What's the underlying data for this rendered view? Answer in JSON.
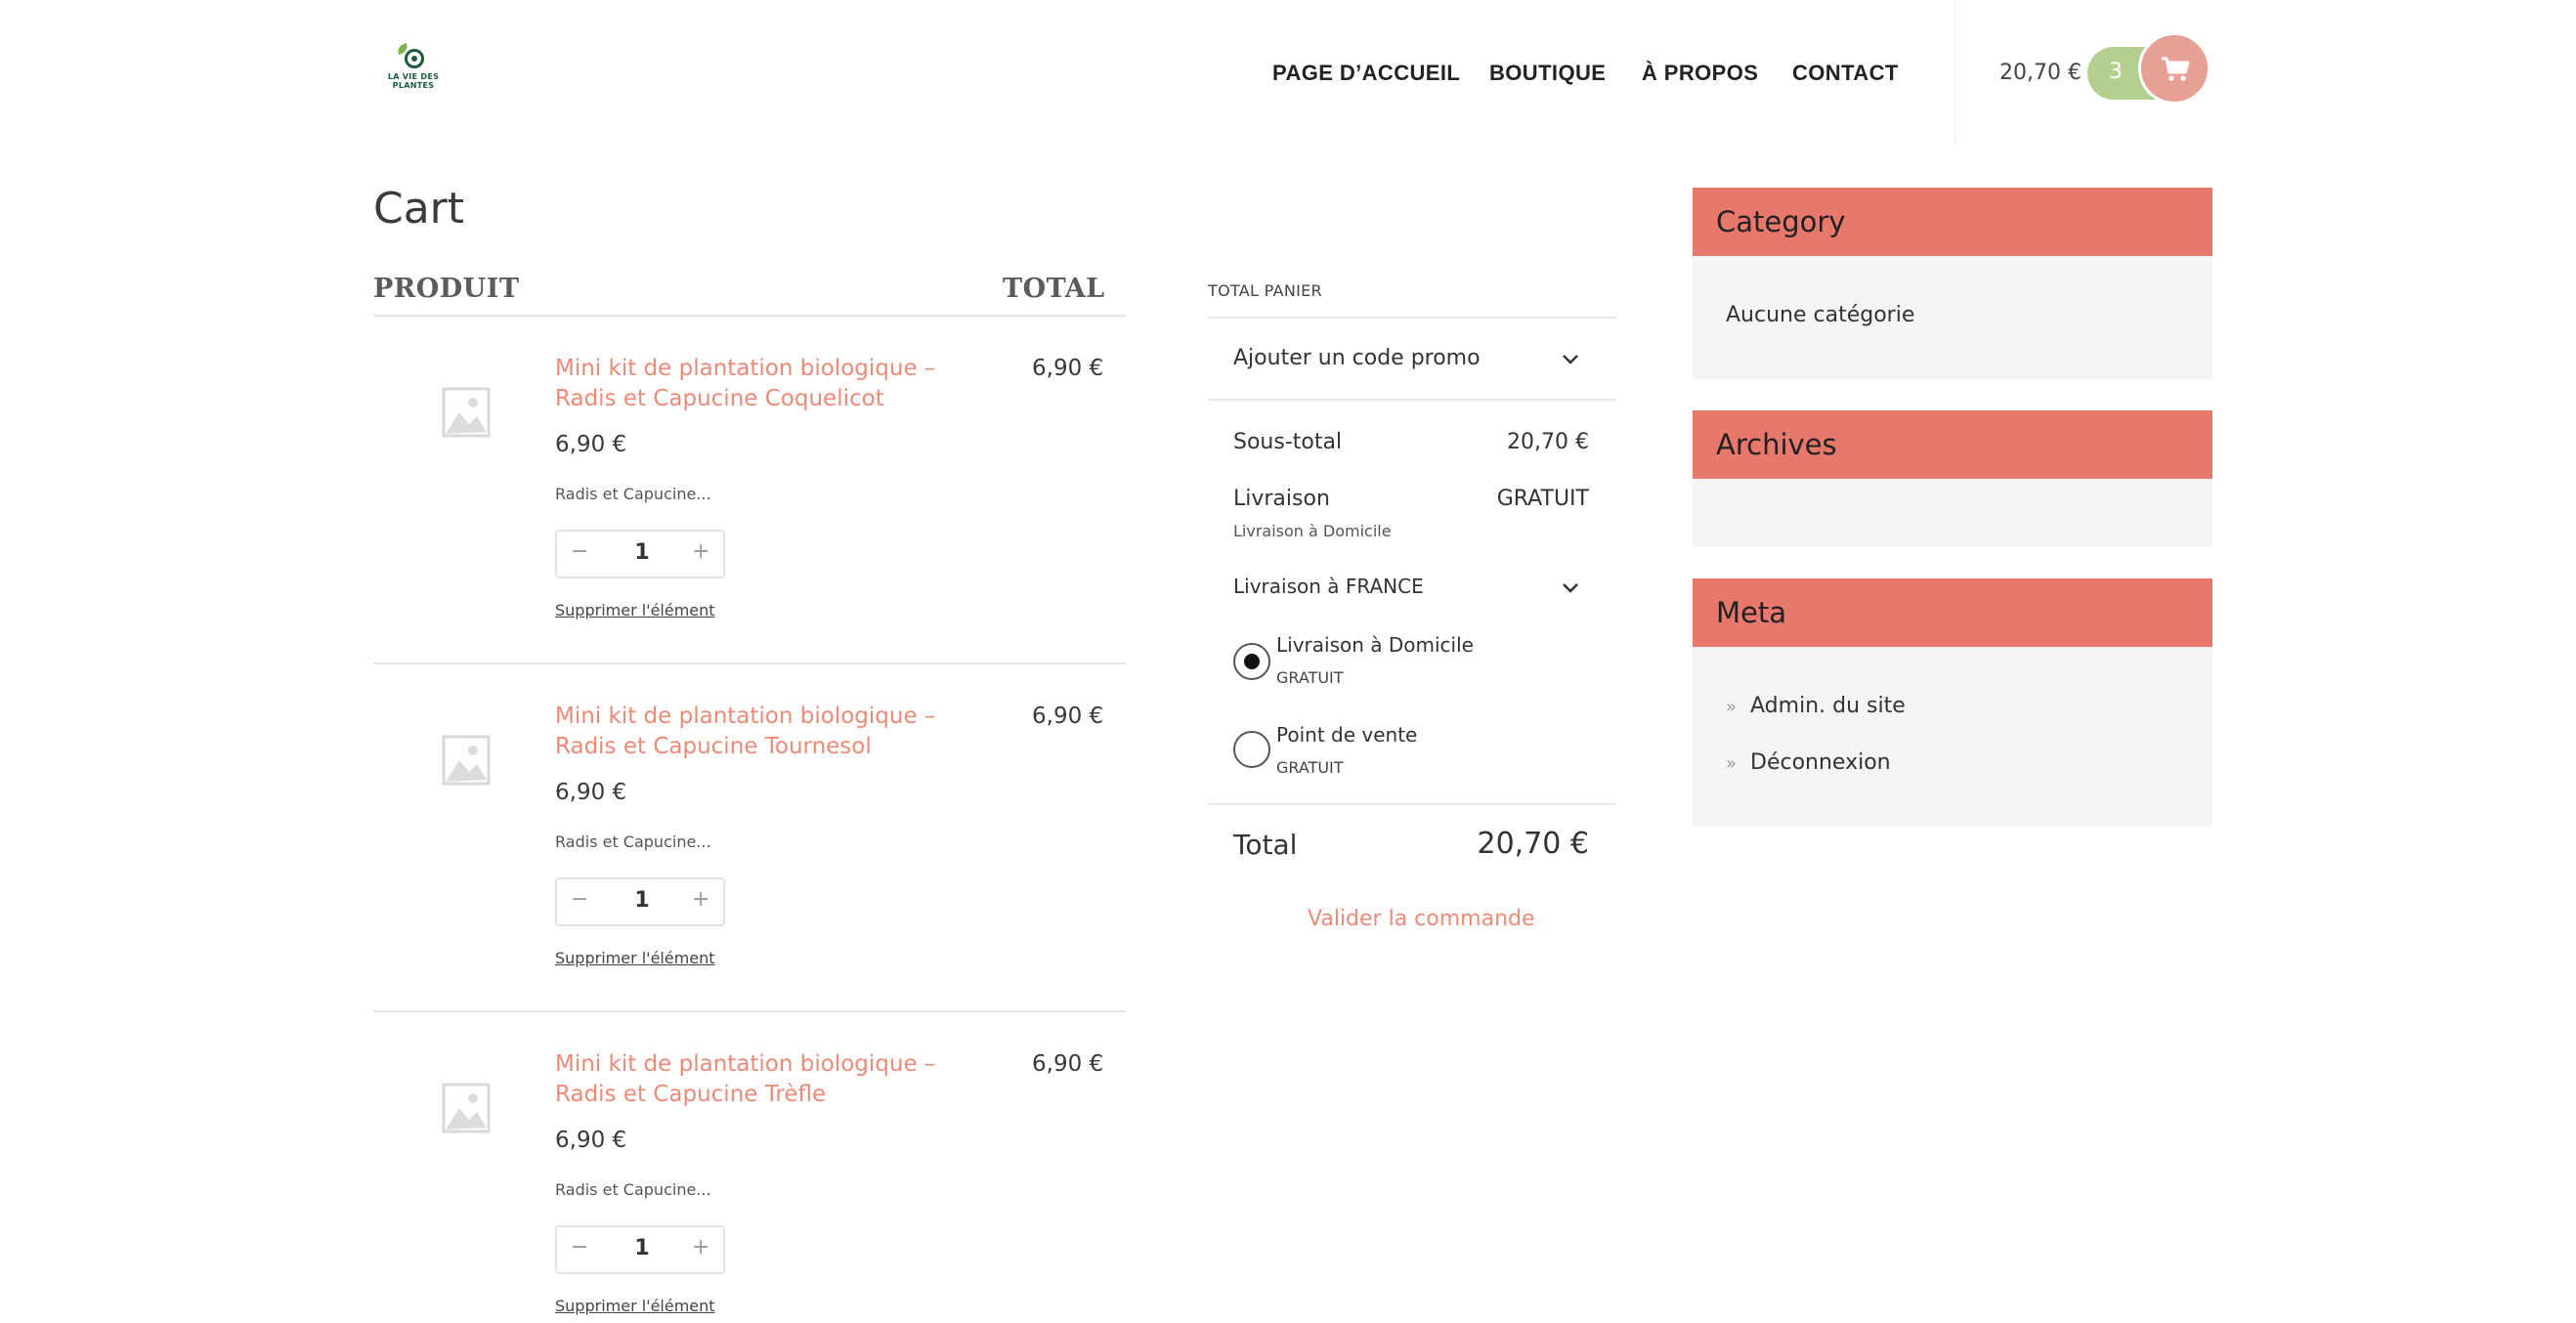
{
  "logo": {
    "text": "LA VIE DES PLANTES"
  },
  "nav": {
    "items": [
      "PAGE D’ACCUEIL",
      "BOUTIQUE",
      "À PROPOS",
      "CONTACT"
    ]
  },
  "header_cart": {
    "total": "20,70 €",
    "count": "3"
  },
  "page": {
    "title": "Cart"
  },
  "cart_table": {
    "col_product": "PRODUIT",
    "col_total": "TOTAL"
  },
  "items": [
    {
      "title": "Mini kit de plantation biologique – Radis et Capucine Coquelicot",
      "price": "6,90 €",
      "subtitle": "Radis et Capucine...",
      "quantity": "1",
      "qty_minus": "−",
      "qty_plus": "+",
      "remove": "Supprimer l'élément",
      "total": "6,90 €"
    },
    {
      "title": "Mini kit de plantation biologique – Radis et Capucine Tournesol",
      "price": "6,90 €",
      "subtitle": "Radis et Capucine...",
      "quantity": "1",
      "qty_minus": "−",
      "qty_plus": "+",
      "remove": "Supprimer l'élément",
      "total": "6,90 €"
    },
    {
      "title": "Mini kit de plantation biologique – Radis et Capucine Trèfle",
      "price": "6,90 €",
      "subtitle": "Radis et Capucine...",
      "quantity": "1",
      "qty_minus": "−",
      "qty_plus": "+",
      "remove": "Supprimer l'élément",
      "total": "6,90 €"
    }
  ],
  "totals": {
    "heading": "TOTAL PANIER",
    "promo": "Ajouter un code promo",
    "subtotal_label": "Sous-total",
    "subtotal_value": "20,70 €",
    "shipping_label": "Livraison",
    "shipping_value": "GRATUIT",
    "shipping_method": "Livraison à Domicile",
    "shipping_country": "Livraison à FRANCE",
    "options": [
      {
        "label": "Livraison à Domicile",
        "price": "GRATUIT",
        "selected": true
      },
      {
        "label": "Point de vente",
        "price": "GRATUIT",
        "selected": false
      }
    ],
    "total_label": "Total",
    "total_value": "20,70 €",
    "checkout": "Valider la commande"
  },
  "sidebar": {
    "category": {
      "title": "Category",
      "text": "Aucune catégorie"
    },
    "archives": {
      "title": "Archives"
    },
    "meta": {
      "title": "Meta",
      "links": [
        "Admin. du site",
        "Déconnexion"
      ]
    }
  },
  "colors": {
    "accent": "#e8776c",
    "link": "#ec8a78",
    "cart_pill": "#b5cf8f",
    "cart_circle": "#e8a096",
    "widget_bg": "#f6f4f4"
  },
  "icons": [
    "logo-icon",
    "cart-icon",
    "image-placeholder-icon",
    "chevron-down-icon",
    "chevron-right-icon"
  ]
}
